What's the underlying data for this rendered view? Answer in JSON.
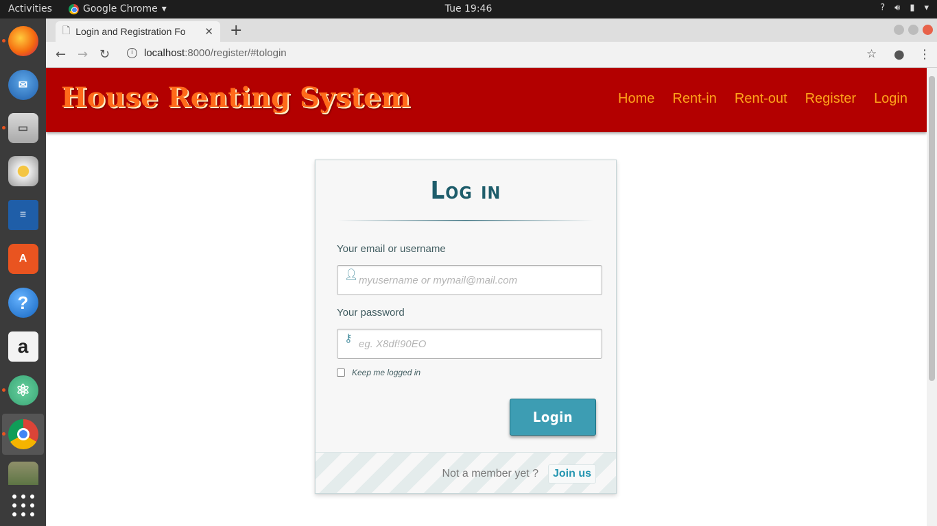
{
  "system": {
    "activities": "Activities",
    "app_name": "Google Chrome",
    "clock": "Tue 19:46",
    "tray_help": "?"
  },
  "dock": {
    "items": [
      {
        "name": "firefox",
        "running": true
      },
      {
        "name": "thunderbird",
        "running": false
      },
      {
        "name": "files",
        "running": true
      },
      {
        "name": "rhythmbox",
        "running": false
      },
      {
        "name": "libreoffice-writer",
        "running": false
      },
      {
        "name": "software-center",
        "running": false
      },
      {
        "name": "help",
        "running": false
      },
      {
        "name": "amazon",
        "running": false
      },
      {
        "name": "atom",
        "running": true
      },
      {
        "name": "chrome",
        "running": true
      },
      {
        "name": "image-viewer",
        "running": false
      },
      {
        "name": "show-applications",
        "running": false
      }
    ]
  },
  "browser": {
    "tab_title": "Login and Registration Fo",
    "url_host": "localhost",
    "url_rest": ":8000/register/#tologin"
  },
  "site": {
    "logo": "House Renting System",
    "nav": [
      "Home",
      "Rent-in",
      "Rent-out",
      "Register",
      "Login"
    ]
  },
  "login": {
    "title": "Log in",
    "email_label": "Your email or username",
    "email_placeholder": "myusername or mymail@mail.com",
    "password_label": "Your password",
    "password_placeholder": "eg. X8df!90EO",
    "keep_logged_in": "Keep me logged in",
    "submit": "Login",
    "footer_text": "Not a member yet ?",
    "join": "Join us"
  },
  "colors": {
    "header_bg": "#b30000",
    "nav_link": "#ffa41b",
    "logo": "#ff6a1a",
    "button": "#3d9db3",
    "title": "#1e5d6b"
  }
}
